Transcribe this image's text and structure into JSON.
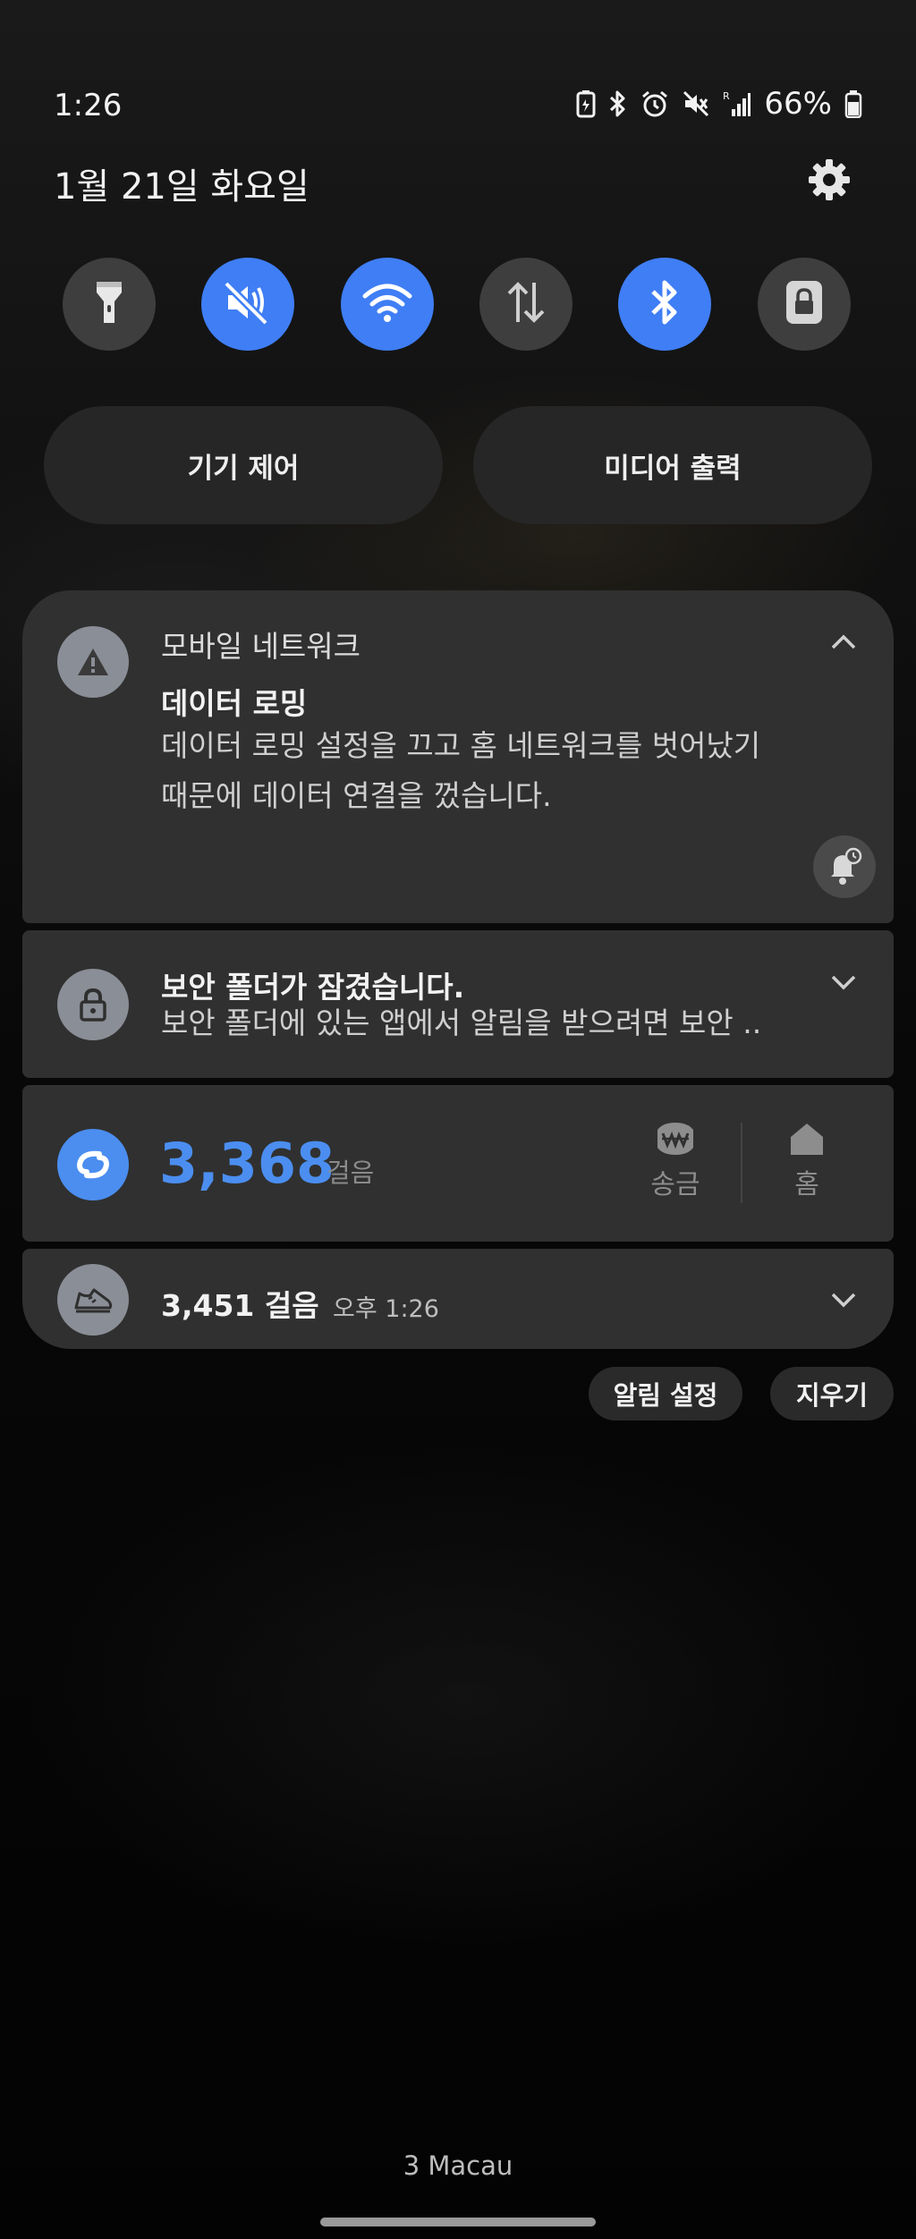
{
  "status_bar": {
    "time": "1:26",
    "battery": "66%",
    "icons": [
      "battery-saver-icon",
      "bluetooth-icon",
      "alarm-icon",
      "vibrate-mute-icon",
      "roaming-signal-icon",
      "battery-icon"
    ]
  },
  "header": {
    "date": "1월 21일 화요일",
    "settings_icon": "gear-icon"
  },
  "quick_toggles": [
    {
      "name": "flashlight",
      "icon": "flashlight-icon",
      "on": false
    },
    {
      "name": "sound",
      "icon": "mute-icon",
      "on": true
    },
    {
      "name": "wifi",
      "icon": "wifi-icon",
      "on": true
    },
    {
      "name": "mobile-data",
      "icon": "data-arrows-icon",
      "on": false
    },
    {
      "name": "bluetooth",
      "icon": "bluetooth-icon",
      "on": true
    },
    {
      "name": "lock",
      "icon": "lock-icon",
      "on": false
    }
  ],
  "pills": {
    "device_control": "기기 제어",
    "media_output": "미디어 출력"
  },
  "notifications": {
    "roaming": {
      "app": "모바일 네트워크",
      "title": "데이터 로밍",
      "body_line1": "데이터 로밍 설정을 끄고 홈 네트워크를 벗어났기",
      "body_line2": "때문에 데이터 연결을 껐습니다."
    },
    "secure_folder": {
      "title": "보안 폴더가 잠겼습니다.",
      "body": "보안 폴더에 있는 앱에서 알림을 받으려면 보안 .."
    },
    "steps_widget": {
      "steps": "3,368",
      "unit": "걸음",
      "action1": "송금",
      "action2": "홈"
    },
    "steps_summary": {
      "title": "3,451 걸음",
      "time": "오후 1:26"
    }
  },
  "actions": {
    "notification_settings": "알림 설정",
    "clear": "지우기"
  },
  "footer": {
    "carrier": "3 Macau"
  },
  "colors": {
    "accent": "#3f7ef5",
    "steps_blue": "#4b8ef0",
    "card": "#303030"
  }
}
